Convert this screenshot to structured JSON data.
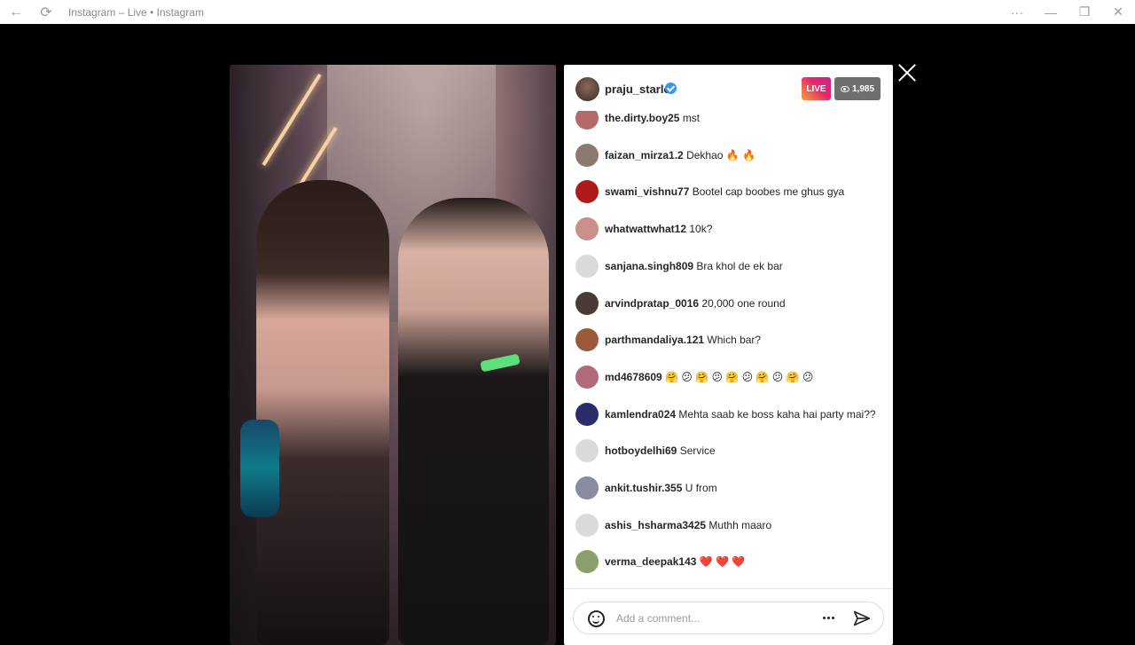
{
  "window": {
    "title": "Instagram – Live • Instagram",
    "back_glyph": "←",
    "refresh_glyph": "⟳",
    "more_glyph": "···",
    "minimize_glyph": "—",
    "restore_glyph": "❐",
    "close_glyph": "✕"
  },
  "live": {
    "host_username": "praju_starlet",
    "live_label": "LIVE",
    "viewer_count": "1,985"
  },
  "comments": [
    {
      "user": "the.dirty.boy25",
      "message": "mst",
      "avatar_color": "#b46a6a"
    },
    {
      "user": "faizan_mirza1.2",
      "message": "Dekhao 🔥 🔥",
      "avatar_color": "#8a7a70"
    },
    {
      "user": "swami_vishnu77",
      "message": "Bootel cap boobes me ghus gya",
      "avatar_color": "#b11a1a"
    },
    {
      "user": "whatwattwhat12",
      "message": "10k?",
      "avatar_color": "#c9908a"
    },
    {
      "user": "sanjana.singh809",
      "message": "Bra khol de ek bar",
      "avatar_color": "#dadada"
    },
    {
      "user": "arvindpratap_0016",
      "message": "20,000 one round",
      "avatar_color": "#4a3a38"
    },
    {
      "user": "parthmandaliya.121",
      "message": "Which bar?",
      "avatar_color": "#9a5a3a"
    },
    {
      "user": "md4678609",
      "message": "🤗 😕 🤗 😕 🤗 😕 🤗 😕 🤗 😕",
      "avatar_color": "#b06a78"
    },
    {
      "user": "kamlendra024",
      "message": "Mehta saab ke boss kaha hai party mai??",
      "avatar_color": "#2a2d6a"
    },
    {
      "user": "hotboydelhi69",
      "message": "Service",
      "avatar_color": "#dadada"
    },
    {
      "user": "ankit.tushir.355",
      "message": "U from",
      "avatar_color": "#8a8aa0"
    },
    {
      "user": "ashis_hsharma3425",
      "message": "Muthh maaro",
      "avatar_color": "#dadada"
    },
    {
      "user": "verma_deepak143",
      "message": "❤️ ❤️ ❤️",
      "avatar_color": "#8aa06a"
    }
  ],
  "composer": {
    "placeholder": "Add a comment..."
  },
  "icons": {
    "emoji": "emoji-icon",
    "more": "more-options-icon",
    "send": "send-icon",
    "close": "close-icon",
    "eye": "eye-icon"
  }
}
